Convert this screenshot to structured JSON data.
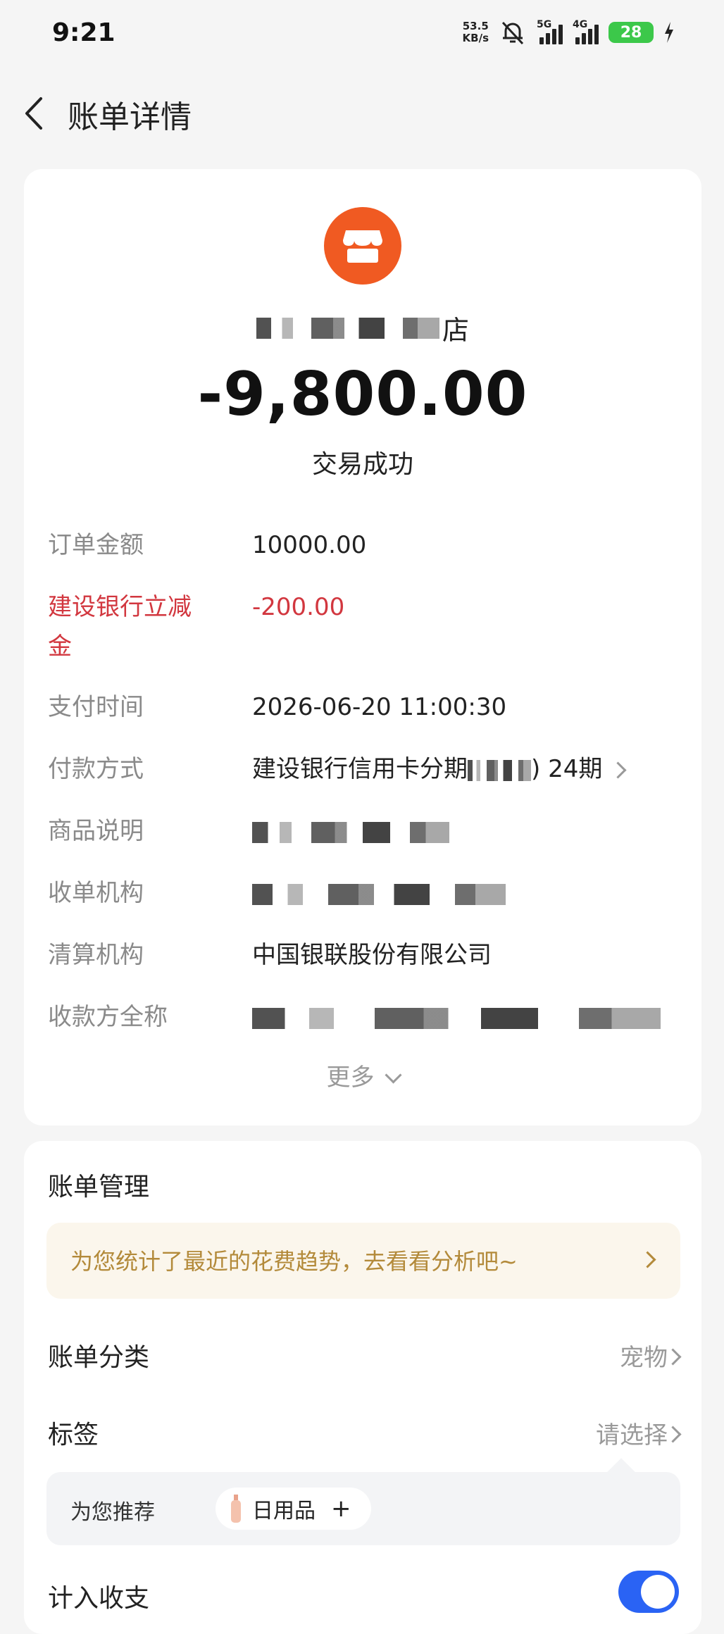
{
  "status_bar": {
    "time": "9:21",
    "net_speed_value": "53.5",
    "net_speed_unit": "KB/s",
    "signal_1_label": "5G",
    "signal_2_label": "4G",
    "battery": "28"
  },
  "header": {
    "title": "账单详情"
  },
  "merchant": {
    "name_suffix": "店",
    "amount": "-9,800.00",
    "status": "交易成功"
  },
  "details": {
    "order_amount_label": "订单金额",
    "order_amount_value": "10000.00",
    "discount_label": "建设银行立减金",
    "discount_value": "-200.00",
    "pay_time_label": "支付时间",
    "pay_time_value": "2026-06-20 11:00:30",
    "pay_method_label": "付款方式",
    "pay_method_prefix": "建设银行信用卡分期",
    "pay_method_suffix": ") 24期",
    "product_label": "商品说明",
    "acquirer_label": "收单机构",
    "clearing_label": "清算机构",
    "clearing_value": "中国银联股份有限公司",
    "payee_label": "收款方全称",
    "more_label": "更多"
  },
  "manage": {
    "title": "账单管理",
    "tip": "为您统计了最近的花费趋势，去看看分析吧~",
    "category_label": "账单分类",
    "category_value": "宠物",
    "tag_label": "标签",
    "tag_value": "请选择",
    "recommend_label": "为您推荐",
    "recommend_tag": "日用品",
    "recommend_plus": "+",
    "include_label": "计入收支",
    "include_enabled": true
  },
  "colors": {
    "accent_red": "#d2373f",
    "merchant_icon": "#f05a22",
    "tip_text": "#b38a3a",
    "toggle_on": "#2a63f4"
  }
}
